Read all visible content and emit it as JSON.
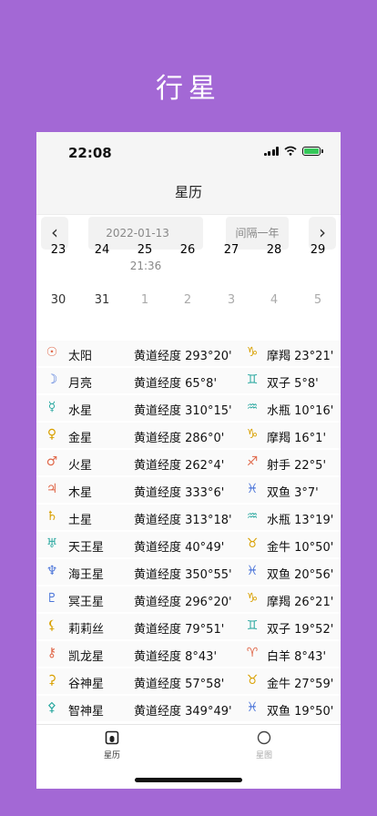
{
  "hero_title": "行星",
  "status": {
    "time": "22:08"
  },
  "nav": {
    "title": "星历"
  },
  "controls": {
    "prev": "‹",
    "next": "›",
    "date": "2022-01-13",
    "time": "21:36",
    "interval": "间隔一年"
  },
  "calendar": {
    "row1": [
      "23",
      "24",
      "25",
      "26",
      "27",
      "28",
      "29"
    ],
    "row2": [
      "30",
      "31",
      "1",
      "2",
      "3",
      "4",
      "5"
    ]
  },
  "planets": [
    {
      "symbol": "☉",
      "name": "太阳",
      "lon": "黄道经度 293°20'",
      "zsym": "♑",
      "zpos": "摩羯 23°21'",
      "color": "#e0684a",
      "zcolor": "#d9a000"
    },
    {
      "symbol": "☽",
      "name": "月亮",
      "lon": "黄道经度 65°8'",
      "zsym": "♊",
      "zpos": "双子 5°8'",
      "color": "#4a74d9",
      "zcolor": "#2aa8a0"
    },
    {
      "symbol": "☿",
      "name": "水星",
      "lon": "黄道经度 310°15'",
      "zsym": "♒",
      "zpos": "水瓶 10°16'",
      "color": "#2aa8a0",
      "zcolor": "#2aa8a0"
    },
    {
      "symbol": "♀",
      "name": "金星",
      "lon": "黄道经度 286°0'",
      "zsym": "♑",
      "zpos": "摩羯 16°1'",
      "color": "#d9a000",
      "zcolor": "#d9a000"
    },
    {
      "symbol": "♂",
      "name": "火星",
      "lon": "黄道经度 262°4'",
      "zsym": "♐",
      "zpos": "射手 22°5'",
      "color": "#e0684a",
      "zcolor": "#e0684a"
    },
    {
      "symbol": "♃",
      "name": "木星",
      "lon": "黄道经度 333°6'",
      "zsym": "♓",
      "zpos": "双鱼 3°7'",
      "color": "#e0684a",
      "zcolor": "#4a74d9"
    },
    {
      "symbol": "♄",
      "name": "土星",
      "lon": "黄道经度 313°18'",
      "zsym": "♒",
      "zpos": "水瓶 13°19'",
      "color": "#d9a000",
      "zcolor": "#2aa8a0"
    },
    {
      "symbol": "♅",
      "name": "天王星",
      "lon": "黄道经度 40°49'",
      "zsym": "♉",
      "zpos": "金牛 10°50'",
      "color": "#2aa8a0",
      "zcolor": "#d9a000"
    },
    {
      "symbol": "♆",
      "name": "海王星",
      "lon": "黄道经度 350°55'",
      "zsym": "♓",
      "zpos": "双鱼 20°56'",
      "color": "#4a74d9",
      "zcolor": "#4a74d9"
    },
    {
      "symbol": "♇",
      "name": "冥王星",
      "lon": "黄道经度 296°20'",
      "zsym": "♑",
      "zpos": "摩羯 26°21'",
      "color": "#4a74d9",
      "zcolor": "#d9a000"
    },
    {
      "symbol": "⚸",
      "name": "莉莉丝",
      "lon": "黄道经度 79°51'",
      "zsym": "♊",
      "zpos": "双子 19°52'",
      "color": "#d9a000",
      "zcolor": "#2aa8a0"
    },
    {
      "symbol": "⚷",
      "name": "凯龙星",
      "lon": "黄道经度 8°43'",
      "zsym": "♈",
      "zpos": "白羊 8°43'",
      "color": "#e0684a",
      "zcolor": "#e0684a"
    },
    {
      "symbol": "⚳",
      "name": "谷神星",
      "lon": "黄道经度 57°58'",
      "zsym": "♉",
      "zpos": "金牛 27°59'",
      "color": "#d9a000",
      "zcolor": "#d9a000"
    },
    {
      "symbol": "⚴",
      "name": "智神星",
      "lon": "黄道经度 349°49'",
      "zsym": "♓",
      "zpos": "双鱼 19°50'",
      "color": "#2aa8a0",
      "zcolor": "#4a74d9"
    }
  ],
  "tabs": [
    {
      "label": "星历",
      "icon": "ephemeris-icon",
      "active": true
    },
    {
      "label": "星图",
      "icon": "chart-circle-icon",
      "active": false
    }
  ],
  "colors": {
    "background": "#a368d5",
    "accent_orange": "#e0684a",
    "accent_gold": "#d9a000",
    "accent_teal": "#2aa8a0",
    "accent_blue": "#4a74d9"
  }
}
